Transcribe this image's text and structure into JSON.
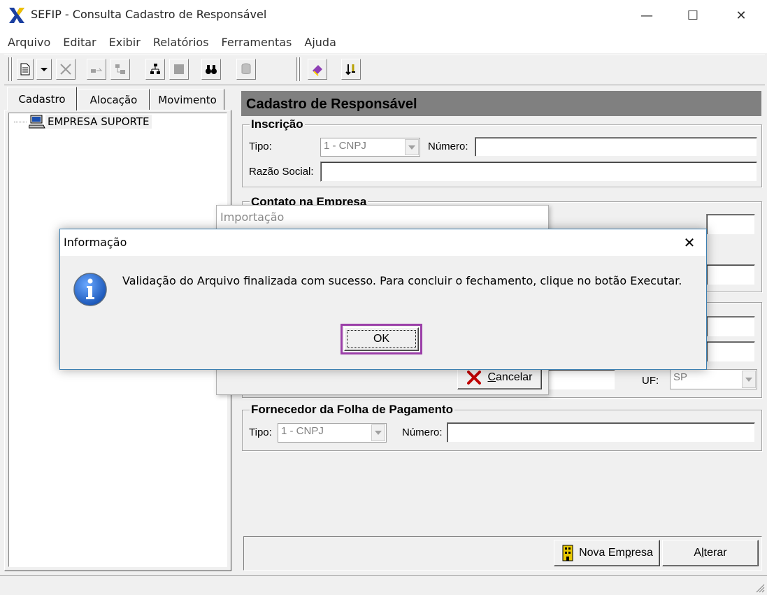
{
  "window": {
    "title": "SEFIP - Consulta Cadastro de Responsável",
    "minimize": "—",
    "maximize": "☐",
    "close": "✕"
  },
  "menu": [
    "Arquivo",
    "Editar",
    "Exibir",
    "Relatórios",
    "Ferramentas",
    "Ajuda"
  ],
  "toolbar_icons": [
    "new-document-icon",
    "dropdown-arrow-icon",
    "delete-x-icon",
    "transfer-icon",
    "layout-icon",
    "hierarchy-icon",
    "stop-icon",
    "binoculars-icon",
    "database-icon",
    "book-icon",
    "sort-icon"
  ],
  "left_tabs": [
    "Cadastro",
    "Alocação",
    "Movimento"
  ],
  "tree": {
    "root_label": "EMPRESA SUPORTE"
  },
  "panel": {
    "header": "Cadastro de Responsável",
    "inscricao": {
      "title": "Inscrição",
      "tipo_label": "Tipo:",
      "tipo_value": "1 - CNPJ",
      "numero_label": "Número:",
      "numero_value": "",
      "razao_label": "Razão Social:",
      "razao_value": ""
    },
    "contato": {
      "title": "Contato na Empresa"
    },
    "uf_label": "UF:",
    "uf_value": "SP",
    "fornecedor": {
      "title": "Fornecedor da Folha de Pagamento",
      "tipo_label": "Tipo:",
      "tipo_value": "1 - CNPJ",
      "numero_label": "Número:",
      "numero_value": ""
    },
    "nova_empresa_prefix": "Nova Em",
    "nova_empresa_mnemonic": "p",
    "nova_empresa_suffix": "resa",
    "alterar_prefix": "A",
    "alterar_mnemonic": "l",
    "alterar_suffix": "terar"
  },
  "import_dialog": {
    "title": "Importação",
    "cancel_mnemonic": "C",
    "cancel_rest": "ancelar"
  },
  "info_dialog": {
    "title": "Informação",
    "close": "✕",
    "message": "Validação do Arquivo finalizada com sucesso. Para concluir o fechamento, clique no botão Executar.",
    "ok_label": "OK"
  },
  "colors": {
    "panel_header_bg": "#808080",
    "dialog_border": "#3c7fb1",
    "ok_highlight": "#9b3fa8",
    "info_icon_blue": "#1a56b8"
  }
}
